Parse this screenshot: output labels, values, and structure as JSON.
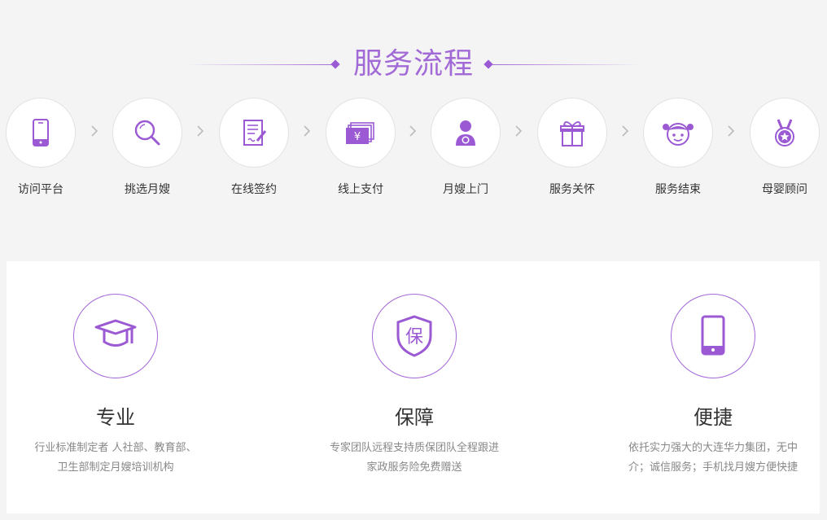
{
  "section_title": "服务流程",
  "accent_color": "#9b5ad3",
  "steps": [
    {
      "label": "访问平台",
      "icon": "mobile-phone-icon"
    },
    {
      "label": "挑选月嫂",
      "icon": "search-icon"
    },
    {
      "label": "在线签约",
      "icon": "contract-sign-icon"
    },
    {
      "label": "线上支付",
      "icon": "yuan-money-icon"
    },
    {
      "label": "月嫂上门",
      "icon": "nanny-baby-icon"
    },
    {
      "label": "服务关怀",
      "icon": "gift-icon"
    },
    {
      "label": "服务结束",
      "icon": "child-face-icon"
    },
    {
      "label": "母婴顾问",
      "icon": "medal-icon"
    }
  ],
  "features": [
    {
      "title": "专业",
      "icon": "graduation-cap-icon",
      "desc_line1": "行业标准制定者 人社部、教育部、",
      "desc_line2": "卫生部制定月嫂培训机构"
    },
    {
      "title": "保障",
      "icon": "shield-icon",
      "icon_char": "保",
      "desc_line1": "专家团队远程支持质保团队全程跟进",
      "desc_line2": "家政服务险免费赠送"
    },
    {
      "title": "便捷",
      "icon": "mobile-phone-icon",
      "desc_line1": "依托实力强大的大连华力集团，无中",
      "desc_line2": "介；诚信服务；手机找月嫂方便快捷"
    }
  ]
}
